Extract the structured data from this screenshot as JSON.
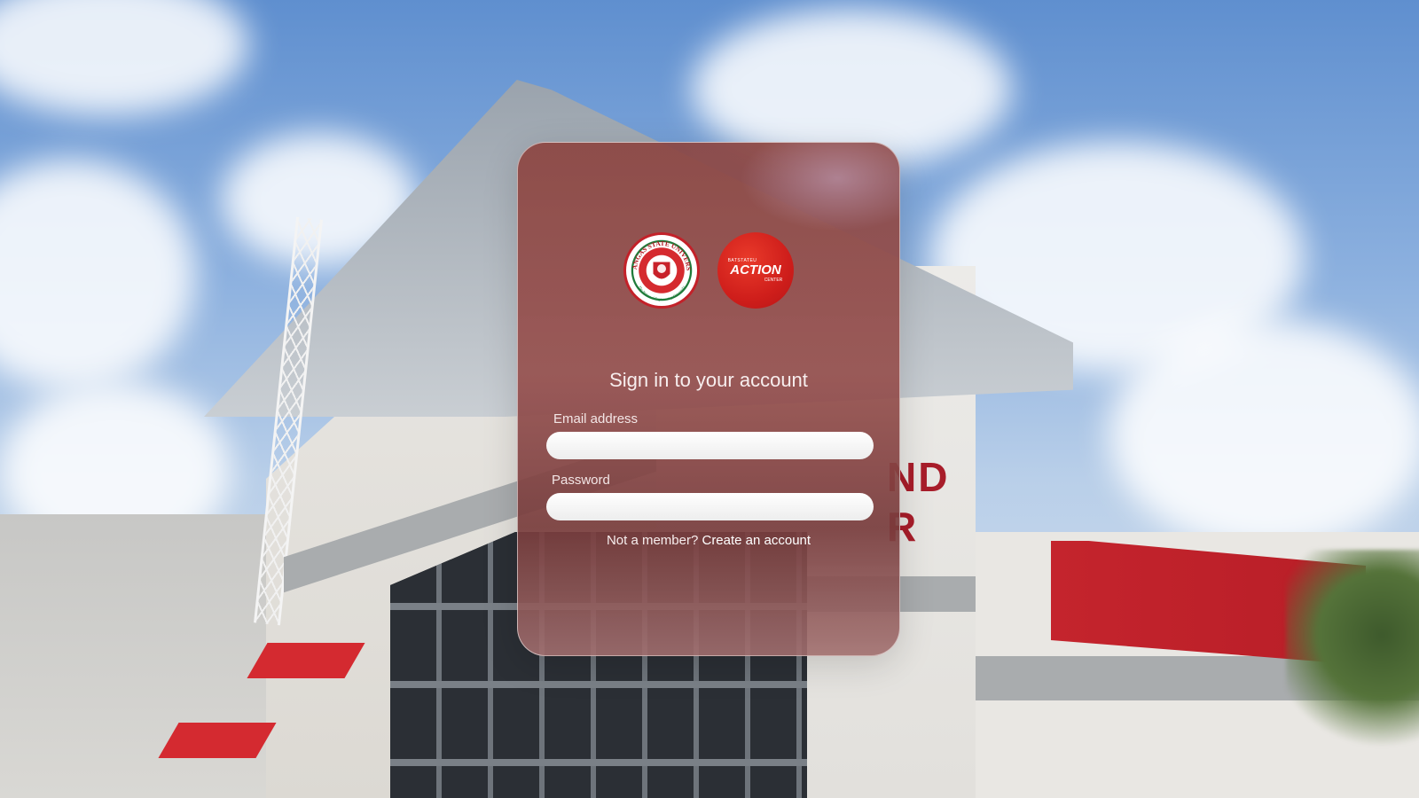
{
  "background": {
    "sign_line_1": "ND",
    "sign_line_2": "R"
  },
  "logos": [
    {
      "name": "Batangas State University seal",
      "arc_text": "BATANGAS STATE UNIVERSITY",
      "motto": "The National Engineering University"
    },
    {
      "name": "BatStateU Action Center",
      "small": "BATSTATEU",
      "big": "ACTION",
      "sub": "CENTER"
    }
  ],
  "form": {
    "title": "Sign in to your account",
    "email_label": "Email address",
    "email_value": "",
    "password_label": "Password",
    "password_value": "",
    "footer_text": "Not a member?",
    "create_link": "Create an account"
  },
  "colors": {
    "card": "#8c4642",
    "accent_red": "#c4242d"
  }
}
